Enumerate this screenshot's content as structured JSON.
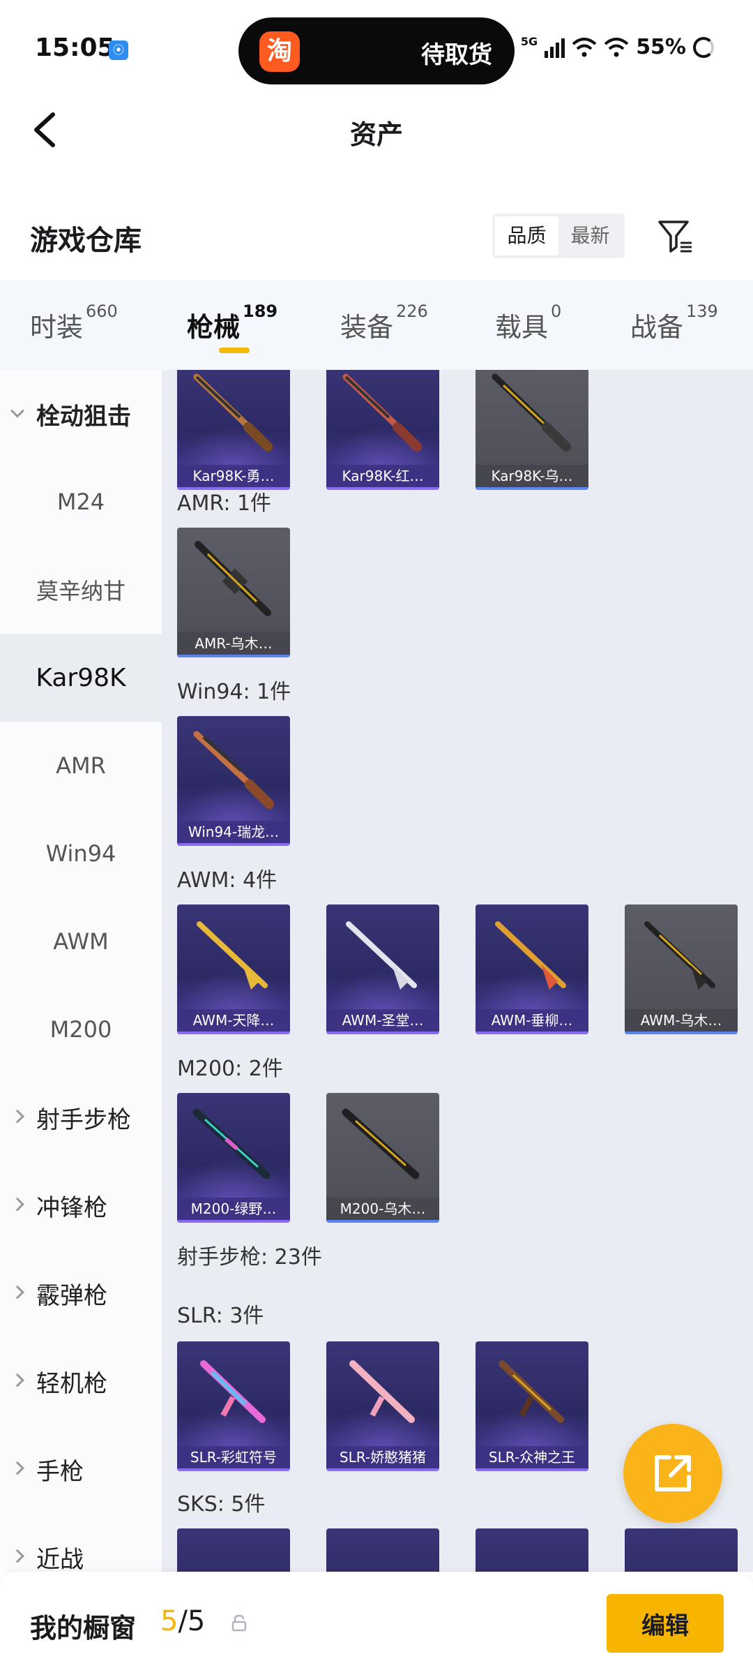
{
  "status_bar": {
    "time": "15:05",
    "nfc_icon": "nfc-icon",
    "island_app_icon": "淘",
    "island_text": "待取货",
    "network": "5G",
    "battery": "55%"
  },
  "nav": {
    "title": "资产",
    "back_icon": "chevron-left-icon"
  },
  "section": {
    "title": "游戏仓库",
    "sort_options": [
      "品质",
      "最新"
    ],
    "sort_selected": "品质",
    "filter_icon": "filter-icon"
  },
  "tabs": [
    {
      "label": "时装",
      "count": "660"
    },
    {
      "label": "枪械",
      "count": "189",
      "active": true
    },
    {
      "label": "装备",
      "count": "226"
    },
    {
      "label": "载具",
      "count": "0"
    },
    {
      "label": "战备",
      "count": "139"
    }
  ],
  "sidebar": {
    "items": [
      {
        "label": "栓动狙击",
        "type": "category",
        "expanded": true
      },
      {
        "label": "M24"
      },
      {
        "label": "莫辛纳甘"
      },
      {
        "label": "Kar98K",
        "active": true
      },
      {
        "label": "AMR"
      },
      {
        "label": "Win94"
      },
      {
        "label": "AWM"
      },
      {
        "label": "M200"
      },
      {
        "label": "射手步枪",
        "type": "category"
      },
      {
        "label": "冲锋枪",
        "type": "category"
      },
      {
        "label": "霰弹枪",
        "type": "category"
      },
      {
        "label": "轻机枪",
        "type": "category"
      },
      {
        "label": "手枪",
        "type": "category"
      },
      {
        "label": "近战",
        "type": "category"
      }
    ]
  },
  "content": {
    "kar98k_items": [
      "Kar98K-勇…",
      "Kar98K-红…",
      "Kar98K-乌…"
    ],
    "amr_label": "AMR: 1件",
    "amr_items": [
      "AMR-乌木…"
    ],
    "win94_label": "Win94: 1件",
    "win94_items": [
      "Win94-瑞龙…"
    ],
    "awm_label": "AWM: 4件",
    "awm_items": [
      "AWM-天降…",
      "AWM-圣堂…",
      "AWM-垂柳…",
      "AWM-乌木…"
    ],
    "m200_label": "M200: 2件",
    "m200_items": [
      "M200-绿野…",
      "M200-乌木…"
    ],
    "dmr_label": "射手步枪: 23件",
    "slr_label": "SLR: 3件",
    "slr_items": [
      "SLR-彩虹符号",
      "SLR-娇憨猪猪",
      "SLR-众神之王"
    ],
    "sks_label": "SKS: 5件"
  },
  "fab": {
    "icon": "share-external-icon"
  },
  "bottom_bar": {
    "label": "我的橱窗",
    "count_current": "5",
    "count_total": "/5",
    "lock_icon": "lock-icon",
    "edit_label": "编辑"
  },
  "colors": {
    "accent": "#f7b500",
    "card_purple": "#3a3576",
    "card_gray": "#5c5d66"
  }
}
